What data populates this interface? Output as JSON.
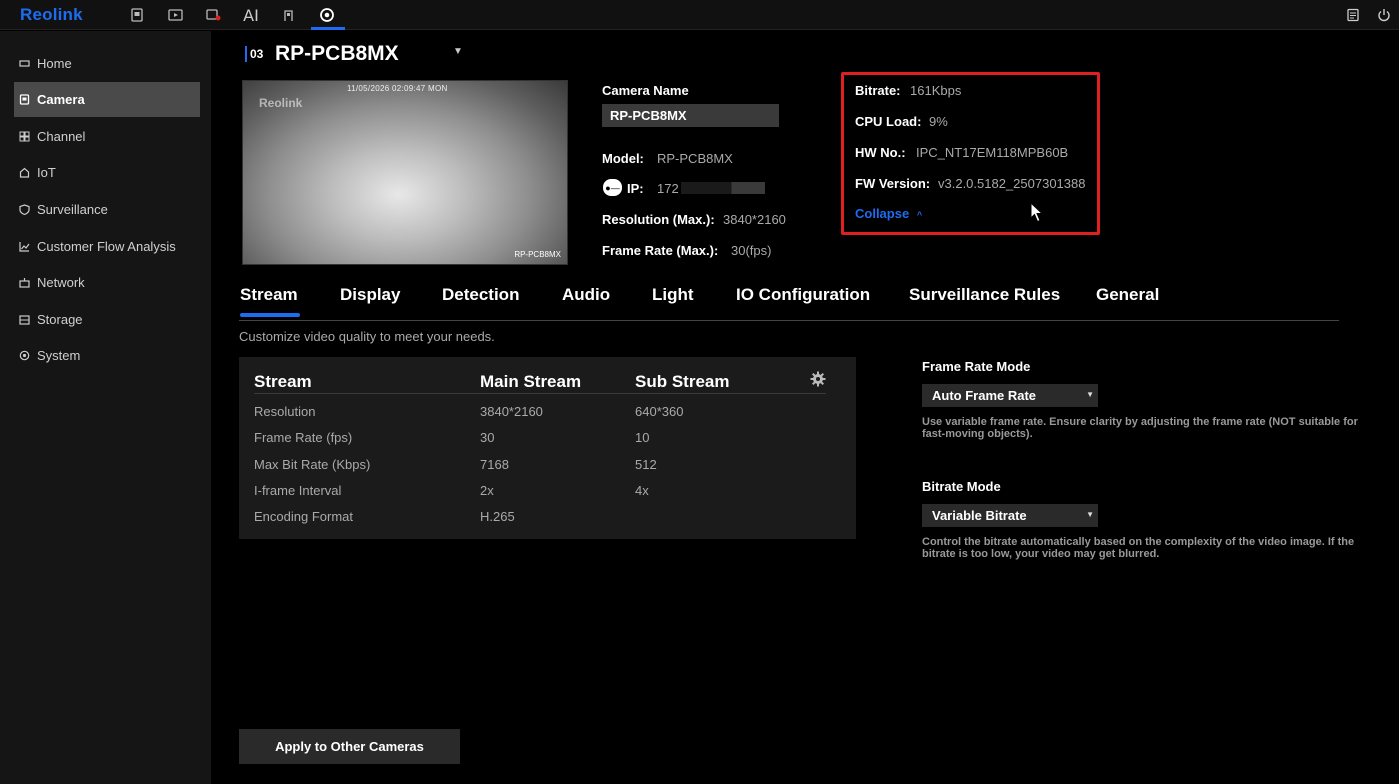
{
  "app": {
    "logo": "Reolink",
    "ai_label": "AI"
  },
  "sidebar": {
    "items": [
      {
        "label": "Home",
        "icon": "home-icon"
      },
      {
        "label": "Camera",
        "icon": "camera-icon",
        "active": true
      },
      {
        "label": "Channel",
        "icon": "grid-icon"
      },
      {
        "label": "IoT",
        "icon": "iot-icon"
      },
      {
        "label": "Surveillance",
        "icon": "shield-icon"
      },
      {
        "label": "Customer Flow Analysis",
        "icon": "chart-icon"
      },
      {
        "label": "Network",
        "icon": "network-icon"
      },
      {
        "label": "Storage",
        "icon": "storage-icon"
      },
      {
        "label": "System",
        "icon": "system-icon"
      }
    ]
  },
  "camera": {
    "channel": "03",
    "title": "RP-PCB8MX",
    "preview": {
      "timestamp": "11/05/2026 02:09:47 MON",
      "watermark": "Reolink",
      "name": "RP-PCB8MX"
    },
    "name_label": "Camera Name",
    "name_value": "RP-PCB8MX",
    "model_label": "Model:",
    "model_value": "RP-PCB8MX",
    "ip_label": "IP:",
    "ip_value": "172",
    "resolution_label": "Resolution (Max.):",
    "resolution_value": "3840*2160",
    "framerate_label": "Frame Rate (Max.):",
    "framerate_value": "30(fps)"
  },
  "details": {
    "bitrate_label": "Bitrate:",
    "bitrate_value": "161Kbps",
    "cpu_label": "CPU Load:",
    "cpu_value": "9%",
    "hw_label": "HW No.:",
    "hw_value": "IPC_NT17EM118MPB60B",
    "fw_label": "FW Version:",
    "fw_value": "v3.2.0.5182_2507301388",
    "collapse_label": "Collapse"
  },
  "tabs": [
    "Stream",
    "Display",
    "Detection",
    "Audio",
    "Light",
    "IO Configuration",
    "Surveillance Rules",
    "General"
  ],
  "stream": {
    "description": "Customize video quality to meet your needs.",
    "headers": [
      "Stream",
      "Main Stream",
      "Sub Stream"
    ],
    "rows": [
      {
        "label": "Resolution",
        "main": "3840*2160",
        "sub": "640*360"
      },
      {
        "label": "Frame Rate (fps)",
        "main": "30",
        "sub": "10"
      },
      {
        "label": "Max Bit Rate (Kbps)",
        "main": "7168",
        "sub": "512"
      },
      {
        "label": "I-frame Interval",
        "main": "2x",
        "sub": "4x"
      },
      {
        "label": "Encoding Format",
        "main": "H.265",
        "sub": ""
      }
    ]
  },
  "settings": {
    "frame_rate_mode_label": "Frame Rate Mode",
    "frame_rate_mode_value": "Auto Frame Rate",
    "frame_rate_mode_desc": "Use variable frame rate. Ensure clarity by adjusting the frame rate (NOT suitable for fast-moving objects).",
    "bitrate_mode_label": "Bitrate Mode",
    "bitrate_mode_value": "Variable Bitrate",
    "bitrate_mode_desc": "Control the bitrate automatically based on the complexity of the video image. If the bitrate is too low, your video may get blurred."
  },
  "apply_button": "Apply to Other Cameras",
  "colors": {
    "accent": "#1e6cf0",
    "highlight_box": "#e02020",
    "background": "#000000",
    "sidebar": "#151515"
  }
}
